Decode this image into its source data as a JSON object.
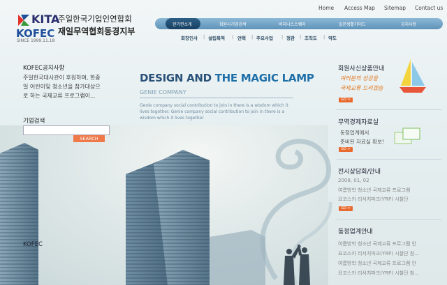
{
  "header": {
    "logo_kita": "KITA",
    "logo_kofec": "KOFEC",
    "logo_since": "SINCE 1999.11.18",
    "org_name_top": "주일한국기업인연합회",
    "org_name_bottom": "재일무역협회동경지부"
  },
  "top_links": [
    "Home",
    "Access Map",
    "Sitemap",
    "Contact us"
  ],
  "nav": {
    "items": [
      "한기련소개",
      "회원사기업검색",
      "비지니스스퀘어",
      "일본생활가이드",
      "공지사항"
    ],
    "selected_index": 0
  },
  "subnav": [
    "회장인사",
    "설립목적",
    "연혁",
    "주요사업",
    "정관",
    "조직도",
    "약도"
  ],
  "left": {
    "notice_title": "KOFEC공지사항",
    "notice_lines": [
      "주일한국대사관이 후원하며, 한중",
      "일 어린이및 청소년을 참가대상으",
      "로 하는 국제교류 프로그램이..."
    ],
    "company_search_title": "기업검색",
    "search_input_value": "",
    "search_button": "SEARCH",
    "kofec_label": "KOFEC"
  },
  "hero": {
    "title_part1": "DESIGN AND ",
    "title_part2": "THE MAGIC LAMP",
    "subtitle": "GENIE COMPANY",
    "body": "Genie company social contribution to join in there is a wisdom which it lives together. Genie company social contribution to join in there is a wisdom which it lives together"
  },
  "right": {
    "member_products_title": "회원사신상품안내",
    "slogan_line1": "여러분의 성공을",
    "slogan_line2": "국제교류 드리겠습",
    "trade_title": "무역경제자료실",
    "trade_lines": [
      "동정업계에서",
      "준비된 자료실 확보!"
    ],
    "exhibition_title": "전시상담회/안내",
    "exhibition_date": "2008, 01, 02",
    "exhibition_lines": [
      "여름방학 청소년 국제교류 프로그램",
      "요코스카 리서치파크(YRP) 시찰단"
    ],
    "industry_title": "동정업계안내",
    "industry_lines": [
      "여름방학 청소년 국제교류 프로그램 안",
      "요코스카 리서치파크(YRP) 시찰단 참...",
      "여름방학 청소년 국제교류 프로그램 안",
      "요코스카 리서치파크(YRP) 시찰단 참..."
    ],
    "go_label": "GO >"
  }
}
